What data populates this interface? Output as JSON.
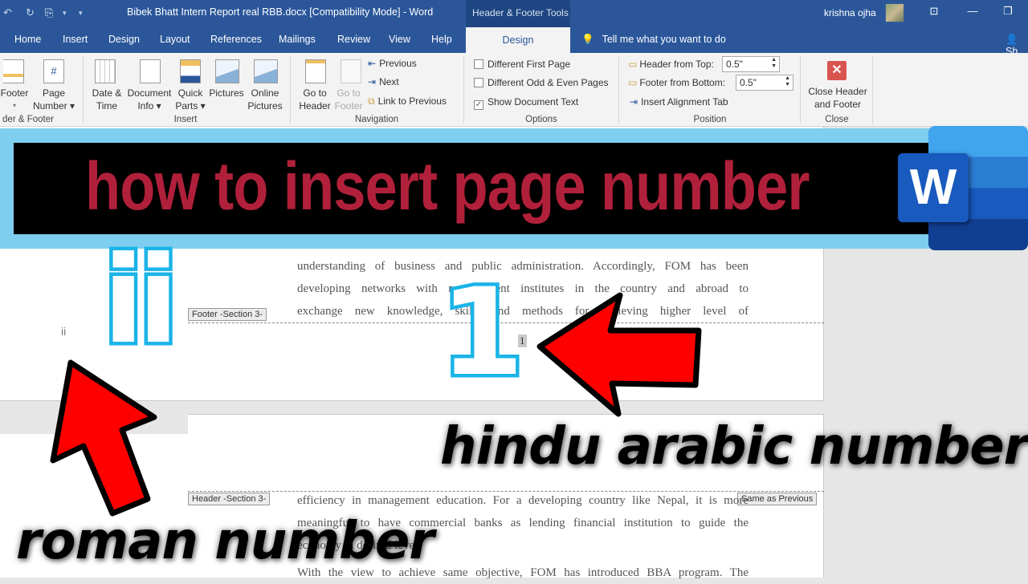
{
  "titlebar": {
    "document_title": "Bibek Bhatt Intern Report real RBB.docx [Compatibility Mode]  -  Word",
    "contextual_group": "Header & Footer Tools",
    "user_name": "krishna ojha",
    "qa_undo": "↶",
    "qa_redo": "↻",
    "qa_check": "⎘",
    "qa_more": "▾",
    "win_ribbon": "⊡",
    "win_minimize": "—",
    "win_restore": "❐"
  },
  "tabs": [
    {
      "label": "Home"
    },
    {
      "label": "Insert"
    },
    {
      "label": "Design"
    },
    {
      "label": "Layout"
    },
    {
      "label": "References"
    },
    {
      "label": "Mailings"
    },
    {
      "label": "Review"
    },
    {
      "label": "View"
    },
    {
      "label": "Help"
    }
  ],
  "active_tab": "Design",
  "tell_me": "Tell me what you want to do",
  "share_label": "Sh",
  "ribbon": {
    "header_footer_group": {
      "label": "der & Footer",
      "footer": "Footer",
      "footer_arrow": "▾",
      "page_number_line1": "Page",
      "page_number_line2": "Number ▾"
    },
    "insert_group": {
      "label": "Insert",
      "date_time": [
        "Date &",
        "Time"
      ],
      "document_info": [
        "Document",
        "Info ▾"
      ],
      "quick_parts": [
        "Quick",
        "Parts ▾"
      ],
      "pictures": [
        "Pictures",
        ""
      ],
      "online_pictures": [
        "Online",
        "Pictures"
      ]
    },
    "navigation_group": {
      "label": "Navigation",
      "go_to_header": [
        "Go to",
        "Header"
      ],
      "go_to_footer": [
        "Go to",
        "Footer"
      ],
      "previous": "Previous",
      "next": "Next",
      "link_to_previous": "Link to Previous"
    },
    "options_group": {
      "label": "Options",
      "different_first_page": {
        "label": "Different First Page",
        "checked": false
      },
      "different_odd_even": {
        "label": "Different Odd & Even Pages",
        "checked": false
      },
      "show_document_text": {
        "label": "Show Document Text",
        "checked": true
      }
    },
    "position_group": {
      "label": "Position",
      "header_from_top_label": "Header from Top:",
      "header_from_top_value": "0.5\"",
      "footer_from_bottom_label": "Footer from Bottom:",
      "footer_from_bottom_value": "0.5\"",
      "insert_alignment_tab": "Insert Alignment Tab"
    },
    "close_group": {
      "label": "Close",
      "close_button": [
        "Close Header",
        "and Footer"
      ]
    }
  },
  "document": {
    "page1_lines": [
      "understanding of business and public administration. Accordingly, FOM has been",
      "developing networks with management institutes in the country and abroad to",
      "exchange new knowledge, skills and methods for achieving higher level of"
    ],
    "footer_tag": "Footer -Section 3-",
    "header_tag": "Header -Section 3-",
    "same_as_previous": "Same as Previous",
    "roman_page_number": "ii",
    "arabic_page_number": "1",
    "page2_lines": [
      "efficiency in management education. For a developing country like Nepal, it is more",
      "meaningful to have commercial banks as lending financial institution to guide the",
      "economy in desired level.",
      "With the view to achieve same objective, FOM has introduced BBA program. The"
    ]
  },
  "overlay": {
    "banner_title": "how to insert page number",
    "word_logo_letter": "W",
    "big_roman": "ii",
    "big_arabic": "1",
    "caption_arabic": "hindu arabic number",
    "caption_roman": "roman number"
  },
  "colors": {
    "word_blue": "#2b579a",
    "banner_red": "#b0203a",
    "banner_frame": "#7ecef0",
    "numeral_outline": "#1ab4e8",
    "arrow_red": "#ff0000"
  }
}
